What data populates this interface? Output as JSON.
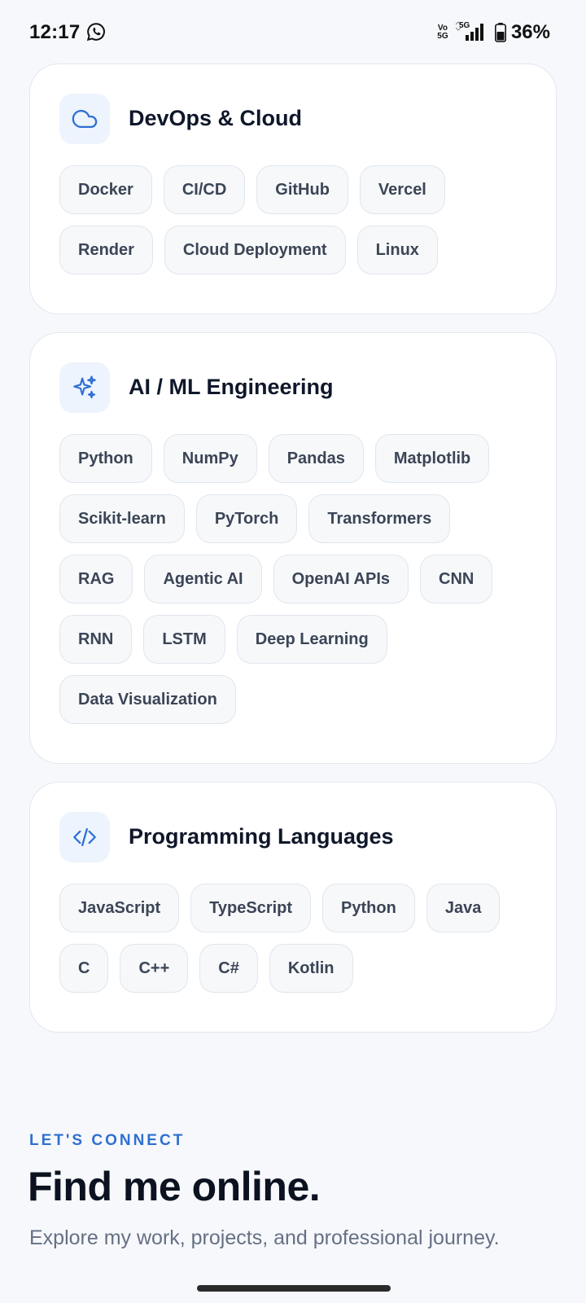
{
  "status_bar": {
    "time": "12:17",
    "network_volte": "Vo 5G",
    "network_type": "5G",
    "battery": "36%"
  },
  "cards": [
    {
      "title": "DevOps & Cloud",
      "icon": "cloud-icon",
      "chips": [
        "Docker",
        "CI/CD",
        "GitHub",
        "Vercel",
        "Render",
        "Cloud Deployment",
        "Linux"
      ]
    },
    {
      "title": "AI / ML Engineering",
      "icon": "sparkles-icon",
      "chips": [
        "Python",
        "NumPy",
        "Pandas",
        "Matplotlib",
        "Scikit-learn",
        "PyTorch",
        "Transformers",
        "RAG",
        "Agentic AI",
        "OpenAI APIs",
        "CNN",
        "RNN",
        "LSTM",
        "Deep Learning",
        "Data Visualization"
      ]
    },
    {
      "title": "Programming Languages",
      "icon": "code-icon",
      "chips": [
        "JavaScript",
        "TypeScript",
        "Python",
        "Java",
        "C",
        "C++",
        "C#",
        "Kotlin"
      ]
    }
  ],
  "connect": {
    "eyebrow": "LET'S CONNECT",
    "headline": "Find me online.",
    "subtext": "Explore my work, projects, and professional journey."
  },
  "colors": {
    "accent": "#2f6fd1",
    "icon_bg": "#edf4fd",
    "chip_bg": "#f6f8fa",
    "page_bg": "#f6f8fb"
  }
}
